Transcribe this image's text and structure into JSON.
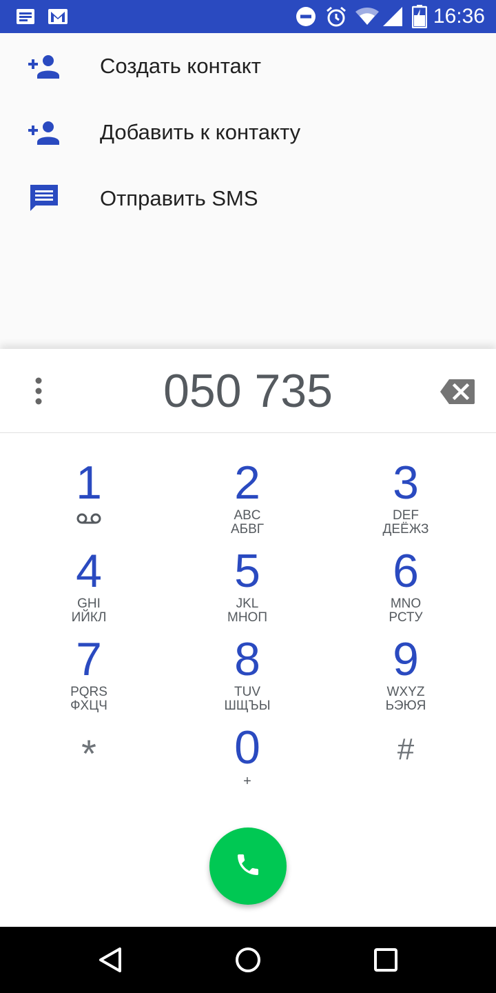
{
  "status_bar": {
    "time": "16:36",
    "bg_color": "#2a4ac0",
    "left_icons": [
      "notification-icon",
      "gmail-icon"
    ],
    "right_icons": [
      "do-not-disturb-icon",
      "alarm-icon",
      "wifi-icon",
      "signal-icon",
      "battery-charging-icon"
    ]
  },
  "suggestions": {
    "items": [
      {
        "label": "Создать контакт",
        "icon": "add-person-icon"
      },
      {
        "label": "Добавить к контакту",
        "icon": "add-person-icon"
      },
      {
        "label": "Отправить SMS",
        "icon": "message-icon"
      }
    ]
  },
  "dialer": {
    "entered_number": "050 735",
    "accent_color": "#2a4ac0",
    "keys": [
      {
        "digit": "1",
        "line1": "",
        "line2": ""
      },
      {
        "digit": "2",
        "line1": "ABC",
        "line2": "АБВГ"
      },
      {
        "digit": "3",
        "line1": "DEF",
        "line2": "ДЕЁЖЗ"
      },
      {
        "digit": "4",
        "line1": "GHI",
        "line2": "ИЙКЛ"
      },
      {
        "digit": "5",
        "line1": "JKL",
        "line2": "МНОП"
      },
      {
        "digit": "6",
        "line1": "MNO",
        "line2": "РСТУ"
      },
      {
        "digit": "7",
        "line1": "PQRS",
        "line2": "ФХЦЧ"
      },
      {
        "digit": "8",
        "line1": "TUV",
        "line2": "ШЩЪЫ"
      },
      {
        "digit": "9",
        "line1": "WXYZ",
        "line2": "ЬЭЮЯ"
      },
      {
        "digit": "*",
        "line1": "",
        "line2": ""
      },
      {
        "digit": "0",
        "line1": "+",
        "line2": ""
      },
      {
        "digit": "#",
        "line1": "",
        "line2": ""
      }
    ],
    "call_button_color": "#00c853"
  },
  "nav_bar": {
    "icons": [
      "back-icon",
      "home-icon",
      "recents-icon"
    ]
  }
}
